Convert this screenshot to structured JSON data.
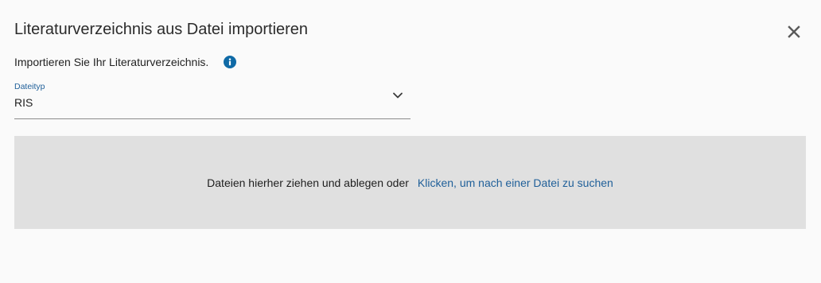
{
  "dialog": {
    "title": "Literaturverzeichnis aus Datei importieren",
    "close_icon": "close-icon"
  },
  "intro": {
    "text": "Importieren Sie Ihr Literaturverzeichnis.",
    "info_icon": "info-icon",
    "info_color": "#0f6aa6"
  },
  "file_type": {
    "label": "Dateityp",
    "value": "RIS",
    "dropdown_icon": "chevron-down-icon"
  },
  "dropzone": {
    "text": "Dateien hierher ziehen und ablegen oder",
    "link_text": "Klicken, um nach einer Datei zu suchen",
    "link_color": "#1f5f99",
    "background": "#e0e0e0"
  }
}
